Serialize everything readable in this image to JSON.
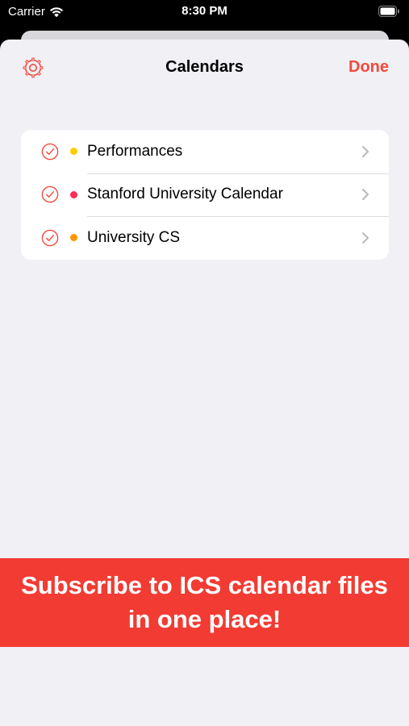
{
  "status_bar": {
    "carrier": "Carrier",
    "time": "8:30 PM",
    "wifi_icon": "wifi-icon",
    "battery_icon": "battery-icon"
  },
  "nav": {
    "title": "Calendars",
    "done_label": "Done",
    "settings_icon": "gear-icon"
  },
  "calendars": [
    {
      "name": "Performances",
      "color": "#ffcc00",
      "checked": true
    },
    {
      "name": "Stanford University Calendar",
      "color": "#ff2d55",
      "checked": true
    },
    {
      "name": "University CS",
      "color": "#ff9500",
      "checked": true
    }
  ],
  "promo": {
    "line1": "Subscribe to ICS calendar files",
    "line2": "in one place!"
  },
  "colors": {
    "accent": "#f1493c",
    "banner": "#f23b32",
    "sheet_background": "#f1f0f5"
  }
}
